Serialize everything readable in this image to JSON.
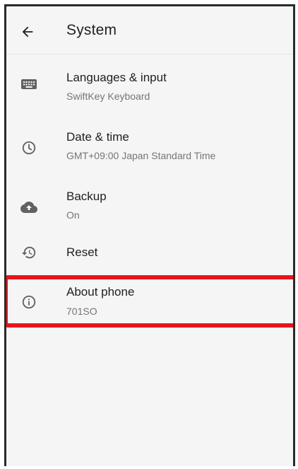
{
  "header": {
    "title": "System",
    "back_icon": "arrow-back-icon"
  },
  "items": [
    {
      "label": "Languages & input",
      "sub": "SwiftKey Keyboard",
      "icon": "keyboard-icon"
    },
    {
      "label": "Date & time",
      "sub": "GMT+09:00 Japan Standard Time",
      "icon": "clock-icon"
    },
    {
      "label": "Backup",
      "sub": "On",
      "icon": "cloud-upload-icon"
    },
    {
      "label": "Reset",
      "icon": "restore-icon"
    },
    {
      "label": "About phone",
      "sub": "701SO",
      "icon": "info-icon"
    }
  ],
  "annotation": {
    "highlight_color": "#e8141c",
    "highlighted_item": "About phone"
  },
  "colors": {
    "background": "#f5f5f5",
    "primary_text": "#212121",
    "secondary_text": "#757575",
    "icon": "#616161"
  }
}
